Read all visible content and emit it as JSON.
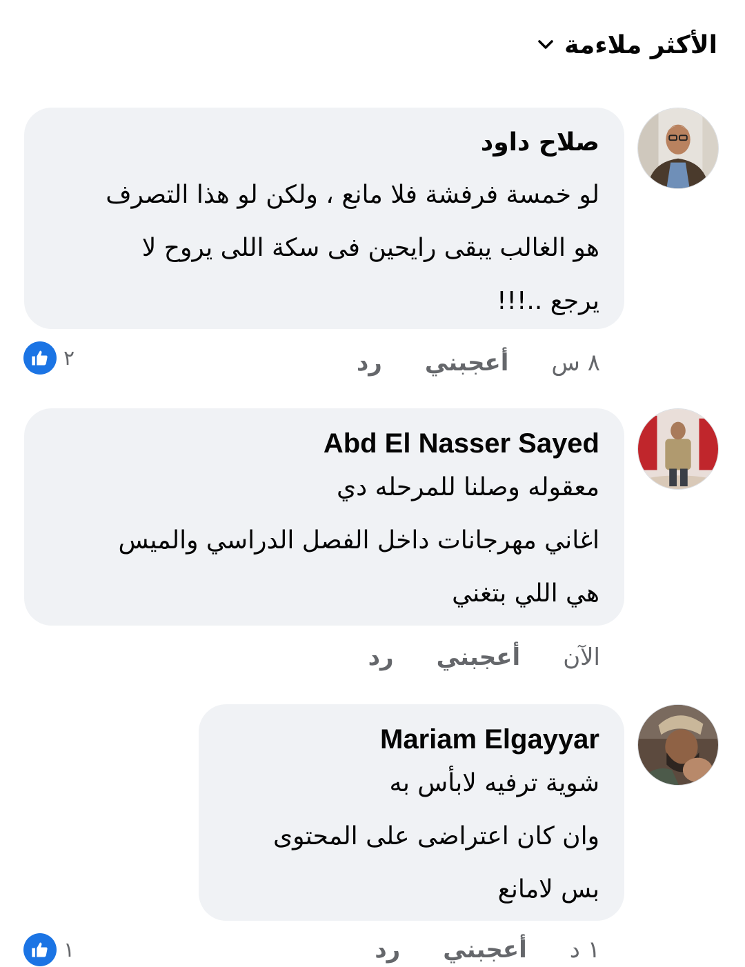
{
  "sort": {
    "label": "الأكثر ملاءمة"
  },
  "comments": [
    {
      "author": "صلاح داود",
      "lines": [
        "لو خمسة فرفشة فلا مانع ، ولكن لو هذا التصرف",
        "هو الغالب يبقى رايحين فى سكة اللى يروح لا",
        "يرجع ..!!!"
      ],
      "time": "٨ س",
      "like_label": "أعجبني",
      "reply_label": "رد",
      "reaction_count": "٢"
    },
    {
      "author": "Abd El Nasser Sayed",
      "lines": [
        "معقوله وصلنا للمرحله دي",
        "اغاني مهرجانات داخل الفصل الدراسي والميس",
        "هي اللي بتغني"
      ],
      "time": "الآن",
      "like_label": "أعجبني",
      "reply_label": "رد"
    },
    {
      "author": "Mariam Elgayyar",
      "lines": [
        "شوية ترفيه لابأس به",
        "وان كان اعتراضى على المحتوى",
        "بس لامانع"
      ],
      "time": "١ د",
      "like_label": "أعجبني",
      "reply_label": "رد",
      "reaction_count": "١"
    }
  ],
  "colors": {
    "bubble": "#f0f2f5",
    "meta_text": "#65676b",
    "like_blue": "#1b74e4"
  }
}
